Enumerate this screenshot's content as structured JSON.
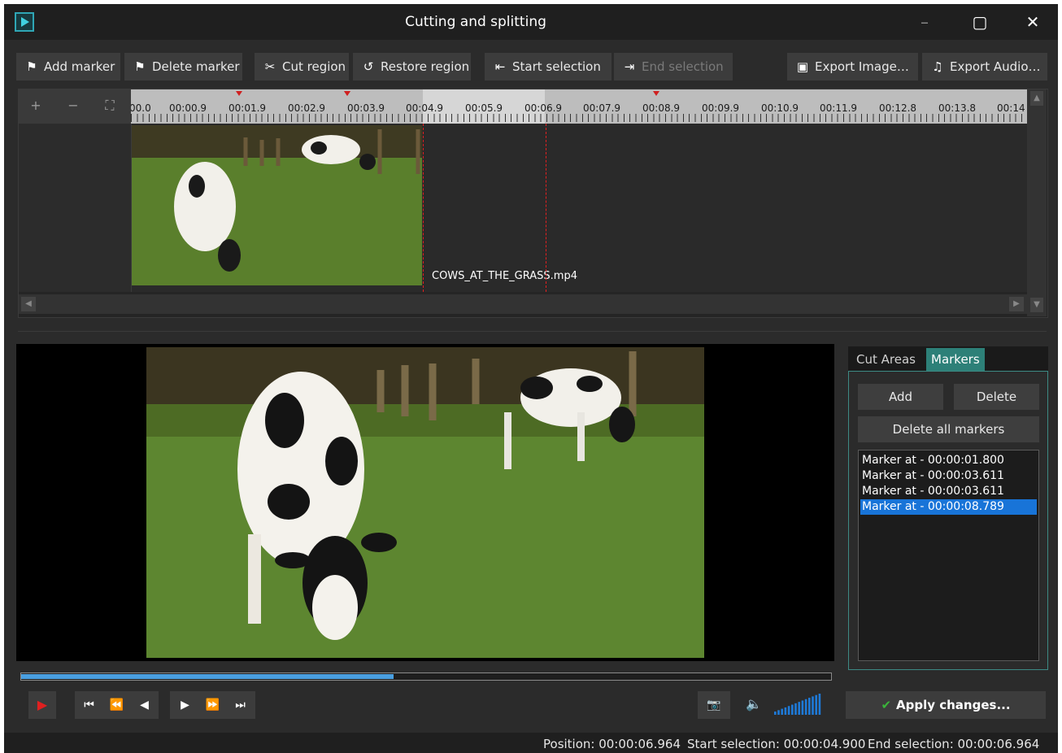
{
  "window": {
    "title": "Cutting and splitting",
    "minimize": "–",
    "maximize": "▢",
    "close": "✕"
  },
  "toolbar": {
    "add_marker": "Add marker",
    "delete_marker": "Delete marker",
    "cut_region": "Cut region",
    "restore_region": "Restore region",
    "start_selection": "Start selection",
    "end_selection": "End selection",
    "export_image": "Export Image…",
    "export_audio": "Export Audio…"
  },
  "timeline": {
    "zoom_in": "+",
    "zoom_out": "−",
    "fit": "⛶",
    "ticks": [
      "00.0",
      "00:00.9",
      "00:01.9",
      "00:02.9",
      "00:03.9",
      "00:04.9",
      "00:05.9",
      "00:06.9",
      "00:07.9",
      "00:08.9",
      "00:09.9",
      "00:10.9",
      "00:11.9",
      "00:12.8",
      "00:13.8",
      "00:14"
    ],
    "clip_name": "COWS_AT_THE_GRASS.mp4"
  },
  "panel": {
    "tabs": [
      "Cut Areas",
      "Markers"
    ],
    "active_tab": "Markers",
    "add_label": "Add",
    "delete_label": "Delete",
    "delete_all_label": "Delete all markers",
    "markers": [
      "Marker at - 00:00:01.800",
      "Marker at - 00:00:03.611",
      "Marker at - 00:00:03.611",
      "Marker at - 00:00:08.789"
    ],
    "selected_index": 3
  },
  "playback": {
    "progress": 0.46,
    "volume_level": 1.0
  },
  "apply_label": "Apply changes...",
  "status": {
    "position": "Position: 00:00:06.964",
    "start_selection": "Start selection: 00:00:04.900",
    "end_selection": "End selection: 00:00:06.964"
  },
  "colors": {
    "accent": "#2d8078",
    "marker": "#e02020",
    "selection": "#1874d8"
  }
}
